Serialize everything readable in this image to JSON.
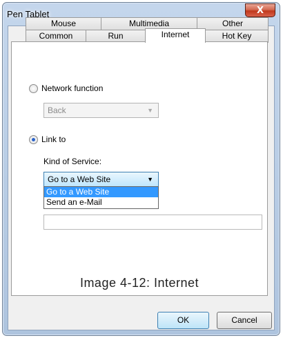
{
  "window": {
    "title": "Pen Tablet",
    "close_glyph": "X"
  },
  "tabs": {
    "row_back": [
      "Mouse",
      "Multimedia",
      "Other"
    ],
    "row_front": [
      "Common",
      "Run",
      "Internet",
      "Hot Key"
    ],
    "active": "Internet"
  },
  "internet": {
    "network_function_label": "Network function",
    "network_combo_value": "Back",
    "link_to_label": "Link to",
    "kind_of_service_label": "Kind of Service:",
    "service_combo_value": "Go to a Web Site",
    "service_options": [
      "Go to a Web Site",
      "Send an e-Mail"
    ],
    "url_value": ""
  },
  "caption": "Image 4-12: Internet",
  "buttons": {
    "ok": "OK",
    "cancel": "Cancel"
  },
  "colors": {
    "selection": "#3399ff",
    "close_button": "#c0381c"
  }
}
